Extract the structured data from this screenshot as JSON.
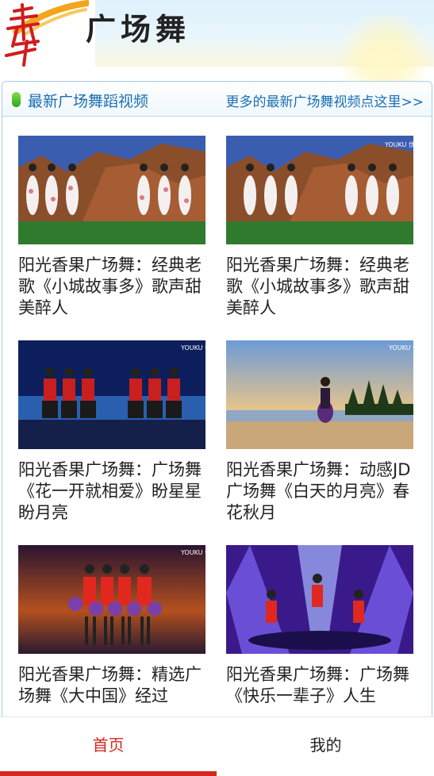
{
  "header": {
    "logo_icon": "dance-calligraphy-logo-icon",
    "title": "广场舞"
  },
  "panel": {
    "title": "最新广场舞蹈视频",
    "more_link": "更多的最新广场舞视频点这里>>"
  },
  "videos": [
    {
      "title": "阳光香果广场舞：经典老歌《小城故事多》歌声甜美醉人",
      "thumb": "canyon-dancers-thumbnail"
    },
    {
      "title": "阳光香果广场舞：经典老歌《小城故事多》歌声甜美醉人",
      "thumb": "canyon-dancers-thumbnail"
    },
    {
      "title": "阳光香果广场舞：广场舞《花一开就相爱》盼星星盼月亮",
      "thumb": "stage-dancers-thumbnail"
    },
    {
      "title": "阳光香果广场舞：动感JD广场舞《白天的月亮》春花秋月",
      "thumb": "beach-dancer-thumbnail"
    },
    {
      "title": "阳光香果广场舞：精选广场舞《大中国》经过",
      "thumb": "pompom-dancers-thumbnail"
    },
    {
      "title": "阳光香果广场舞：广场舞《快乐一辈子》人生",
      "thumb": "purple-stage-dancers-thumbnail"
    }
  ],
  "nav": {
    "home": "首页",
    "mine": "我的",
    "active_color": "#d3291e"
  },
  "watermark": "YOUKU 优酷"
}
